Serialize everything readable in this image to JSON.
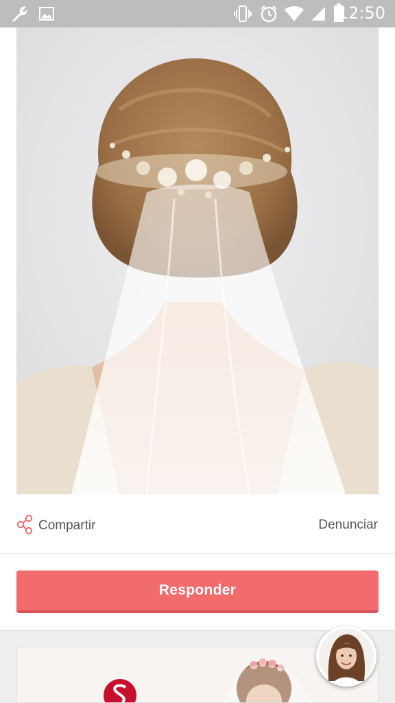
{
  "status_bar": {
    "time": "12:50",
    "icons": [
      "wrench-icon",
      "image-icon",
      "vibrate-icon",
      "alarm-icon",
      "wifi-icon",
      "signal-icon",
      "battery-icon"
    ]
  },
  "post": {
    "photo_icon": "bride-veil-photo"
  },
  "actions": {
    "share_label": "Compartir",
    "share_icon": "share-icon",
    "report_label": "Denunciar"
  },
  "reply": {
    "label": "Responder"
  },
  "colors": {
    "accent": "#f26c6e",
    "accent_dark": "#d85356",
    "status_bar": "#bdbdbd",
    "text_secondary": "#555555",
    "logo_red": "#c8102e"
  }
}
